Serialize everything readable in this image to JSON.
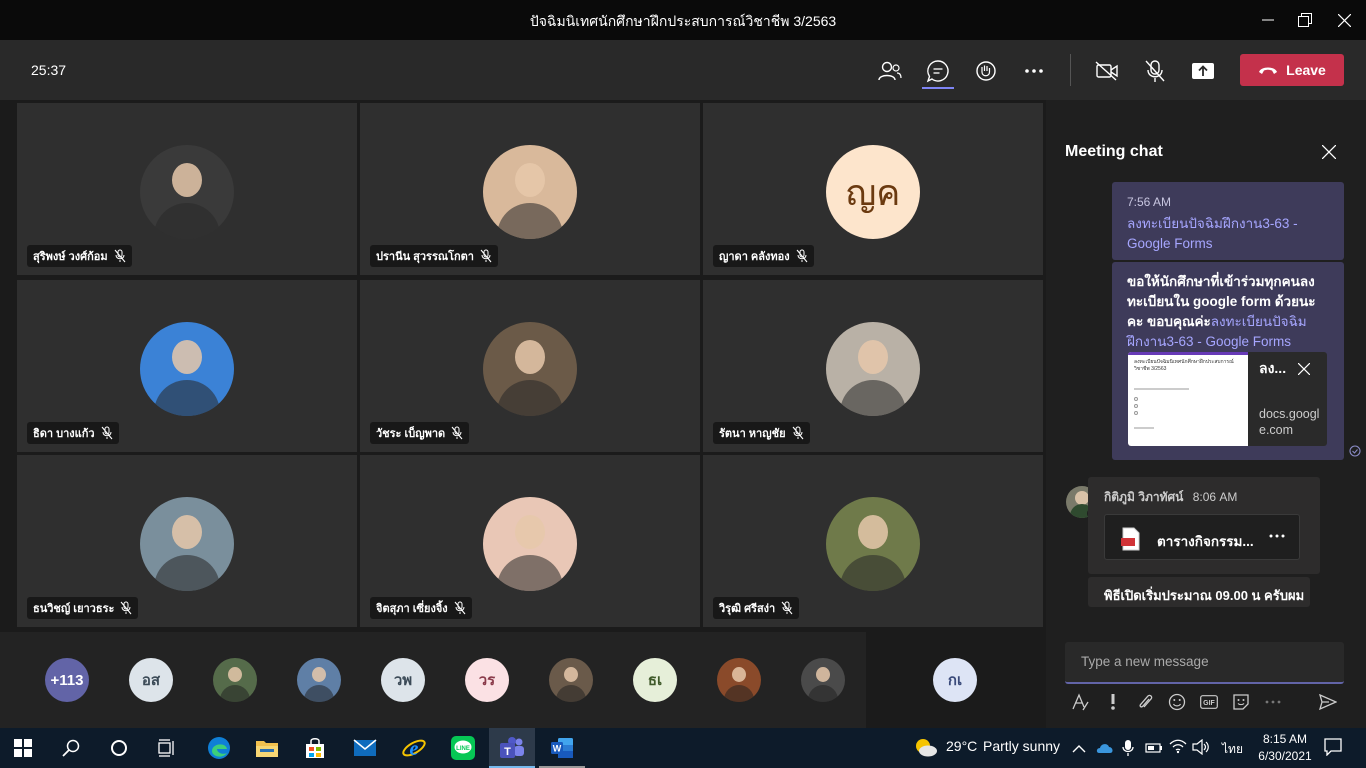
{
  "window": {
    "title": "ปัจฉิมนิเทศนักศึกษาฝึกประสบการณ์วิชาชีพ 3/2563"
  },
  "toolbar": {
    "timer": "25:37",
    "leave_label": "Leave"
  },
  "participants": [
    {
      "name": "สุริพงษ์ วงศ์ก้อม",
      "avatar_color": "#3a3a3a"
    },
    {
      "name": "ปรานีน สุวรรณโกตา",
      "avatar_color": "#d9b99b"
    },
    {
      "name": "ญาดา คลังทอง",
      "initials": "ญค",
      "avatar_color": "#fde5cc"
    },
    {
      "name": "ธิดา บางแก้ว",
      "avatar_color": "#3b82d6"
    },
    {
      "name": "วัชระ เบ็ญพาด",
      "avatar_color": "#6b5a48"
    },
    {
      "name": "รัตนา หาญชัย",
      "avatar_color": "#b9b1a6"
    },
    {
      "name": "ธนวิชญ์ เยาวธระ",
      "avatar_color": "#7a8f9c"
    },
    {
      "name": "จิตสุภา เซี่ยงจิ้ง",
      "avatar_color": "#e9c7b6"
    },
    {
      "name": "วิรุฒิ ศรีสง่า",
      "avatar_color": "#6f7a4a"
    }
  ],
  "strip": [
    {
      "label": "+113",
      "bg": "#6264a7",
      "fg": "#ffffff"
    },
    {
      "label": "อส",
      "bg": "#dde4ea",
      "fg": "#3b4a57"
    },
    {
      "label": "",
      "bg": "#556b4a",
      "fg": "#ffffff"
    },
    {
      "label": "",
      "bg": "#5f7fa6",
      "fg": "#ffffff"
    },
    {
      "label": "วพ",
      "bg": "#dde4ea",
      "fg": "#3b4a57"
    },
    {
      "label": "วร",
      "bg": "#fbe1e4",
      "fg": "#8a3a4a"
    },
    {
      "label": "",
      "bg": "#6a5a4a",
      "fg": "#ffffff"
    },
    {
      "label": "ธเ",
      "bg": "#e6efd9",
      "fg": "#3f5a2a"
    },
    {
      "label": "",
      "bg": "#8a4a2a",
      "fg": "#ffffff"
    },
    {
      "label": "",
      "bg": "#4a4a4a",
      "fg": "#ffffff"
    },
    {
      "label": "กเ",
      "bg": "#dde4f5",
      "fg": "#3a4a7a"
    }
  ],
  "chat": {
    "title": "Meeting chat",
    "msg1": {
      "time": "7:56 AM",
      "link": "ลงทะเบียนปัจฉิมฝึกงาน3-63 - Google Forms"
    },
    "msg2": {
      "text": "ขอให้นักศึกษาที่เข้าร่วมทุกคนลงทะเบียนใน google form ด้วยนะคะ ขอบคุณค่ะ",
      "link": "ลงทะเบียนปัจฉิมฝึกงาน3-63 - Google Forms",
      "card_title": "ลง...",
      "card_domain": "docs.google.com",
      "card_preview_title": "ลงทะเบียนปัจฉิมนิเทศนักศึกษาฝึกประสบการณ์วิชาชีพ 3/2563"
    },
    "msg3": {
      "sender": "กิติภูมิ วิภาทัศน์",
      "time": "8:06 AM",
      "file_name": "ตารางกิจกรรม...",
      "text": "พิธีเปิดเริ่มประมาณ 09.00 น ครับผม"
    },
    "composer_placeholder": "Type a new message"
  },
  "taskbar": {
    "weather_temp": "29°C",
    "weather_text": "Partly sunny",
    "language": "ไทย",
    "time": "8:15 AM",
    "date": "6/30/2021"
  },
  "colors": {
    "accent": "#6264a7",
    "leave": "#c4314b"
  }
}
